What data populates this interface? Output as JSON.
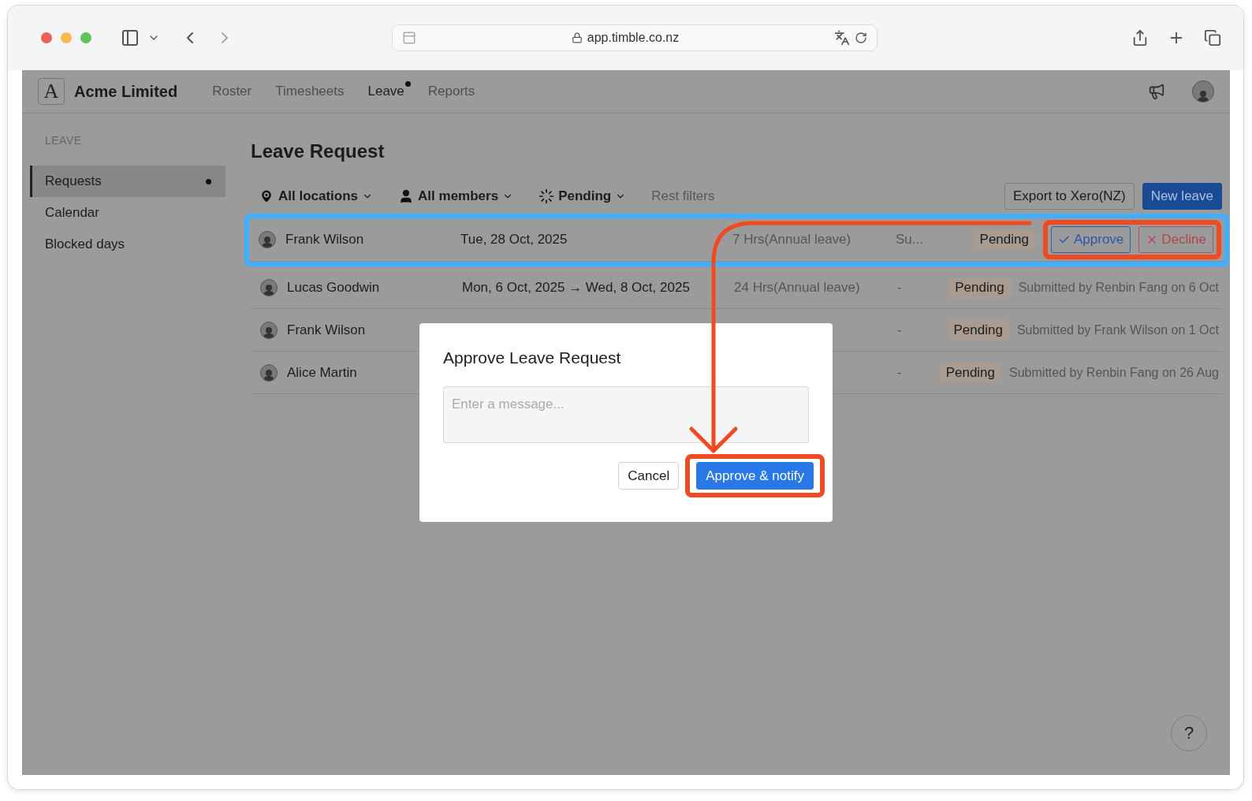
{
  "browser": {
    "url": "app.timble.co.nz"
  },
  "app": {
    "logo_letter": "A",
    "company": "Acme Limited",
    "nav": [
      {
        "label": "Roster",
        "selected": false,
        "dot": false
      },
      {
        "label": "Timesheets",
        "selected": false,
        "dot": false
      },
      {
        "label": "Leave",
        "selected": true,
        "dot": true
      },
      {
        "label": "Reports",
        "selected": false,
        "dot": false
      }
    ]
  },
  "sidebar": {
    "heading": "LEAVE",
    "items": [
      {
        "label": "Requests",
        "selected": true,
        "dot": true
      },
      {
        "label": "Calendar",
        "selected": false,
        "dot": false
      },
      {
        "label": "Blocked days",
        "selected": false,
        "dot": false
      }
    ]
  },
  "page": {
    "title": "Leave Request",
    "filters": [
      {
        "kind": "location",
        "label": "All locations"
      },
      {
        "kind": "member",
        "label": "All members"
      },
      {
        "kind": "status",
        "label": "Pending"
      },
      {
        "kind": "reset",
        "label": "Rest filters"
      }
    ],
    "actions": [
      {
        "kind": "secondary",
        "label": "Export to Xero(NZ)"
      },
      {
        "kind": "primary",
        "label": "New leave"
      }
    ]
  },
  "rows": [
    {
      "name": "Frank Wilson",
      "date": "Tue, 28 Oct, 2025",
      "hours": "7 Hrs(Annual leave)",
      "column_5": "Su...",
      "status": "Pending",
      "highlighted": true,
      "actions": [
        {
          "kind": "approve",
          "label": "Approve"
        },
        {
          "kind": "decline",
          "label": "Decline"
        }
      ]
    },
    {
      "name": "Lucas Goodwin",
      "date": "Mon, 6 Oct, 2025 → Wed, 8 Oct, 2025",
      "hours": "24 Hrs(Annual leave)",
      "column_5": "-",
      "status": "Pending",
      "highlighted": false,
      "note": "Submitted by Renbin Fang on 6 Oct"
    },
    {
      "name": "Frank Wilson",
      "column_5": "-",
      "status": "Pending",
      "highlighted": false,
      "note": "Submitted by Frank Wilson on 1 Oct"
    },
    {
      "name": "Alice Martin",
      "column_5": "-",
      "status": "Pending",
      "highlighted": false,
      "note": "Submitted by Renbin Fang on 26 Aug"
    }
  ],
  "dialog": {
    "title": "Approve Leave Request",
    "placeholder": "Enter a message...",
    "buttons": [
      {
        "kind": "secondary",
        "label": "Cancel",
        "highlighted": false
      },
      {
        "kind": "primary",
        "label": "Approve & notify",
        "highlighted": true
      }
    ]
  },
  "help": "?"
}
